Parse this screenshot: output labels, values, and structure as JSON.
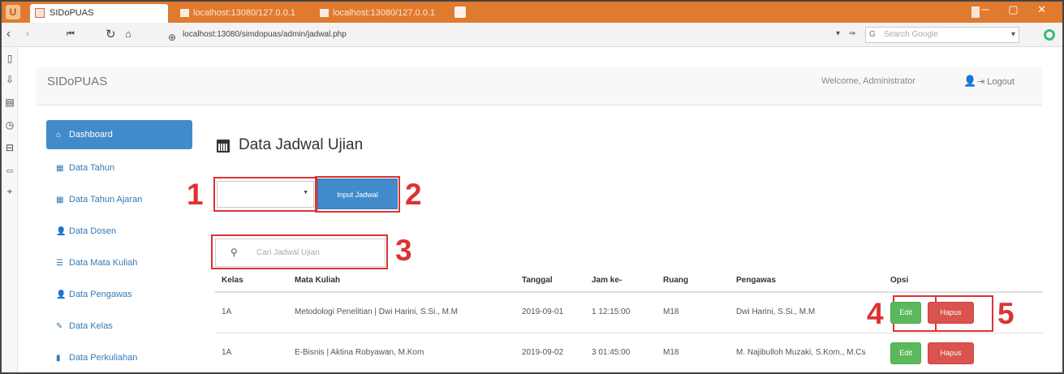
{
  "browser": {
    "tabs": [
      {
        "label": "SIDoPUAS"
      },
      {
        "label": "localhost:13080/127.0.0.1"
      },
      {
        "label": "localhost:13080/127.0.0.1"
      }
    ],
    "url": "localhost:13080/simdopuas/admin/jadwal.php",
    "search_placeholder": "Search Google"
  },
  "app": {
    "brand": "SIDoPUAS",
    "welcome": "Welcome, Administrator",
    "logout_label": "Logout"
  },
  "sidebar": {
    "items": [
      {
        "label": "Dashboard",
        "icon": "home-icon"
      },
      {
        "label": "Data Tahun",
        "icon": "table-icon"
      },
      {
        "label": "Data Tahun Ajaran",
        "icon": "table-icon"
      },
      {
        "label": "Data Dosen",
        "icon": "user-icon"
      },
      {
        "label": "Data Mata Kuliah",
        "icon": "list-icon"
      },
      {
        "label": "Data Pengawas",
        "icon": "user-icon"
      },
      {
        "label": "Data Kelas",
        "icon": "pencil-icon"
      },
      {
        "label": "Data Perkuliahan",
        "icon": "book-icon"
      }
    ]
  },
  "main": {
    "title": "Data Jadwal Ujian",
    "input_button": "Input Jadwal",
    "search_placeholder": "Cari Jadwal Ujian",
    "callouts": [
      "1",
      "2",
      "3",
      "4",
      "5"
    ],
    "table": {
      "headers": [
        "Kelas",
        "Mata Kuliah",
        "Tanggal",
        "Jam ke-",
        "Ruang",
        "Pengawas",
        "Opsi"
      ],
      "rows": [
        {
          "kelas": "1A",
          "matkul": "Metodologi Penelitian | Dwi Harini, S.Si., M.M",
          "tanggal": "2019-09-01",
          "jam": "1 12:15:00",
          "ruang": "M18",
          "pengawas": "Dwi Harini, S.Si., M.M"
        },
        {
          "kelas": "1A",
          "matkul": "E-Bisnis | Aktina Robyawan, M.Kom",
          "tanggal": "2019-09-02",
          "jam": "3 01:45:00",
          "ruang": "M18",
          "pengawas": "M. Najibulloh Muzaki, S.Kom., M.Cs"
        }
      ],
      "edit_label": "Edit",
      "delete_label": "Hapus"
    }
  }
}
